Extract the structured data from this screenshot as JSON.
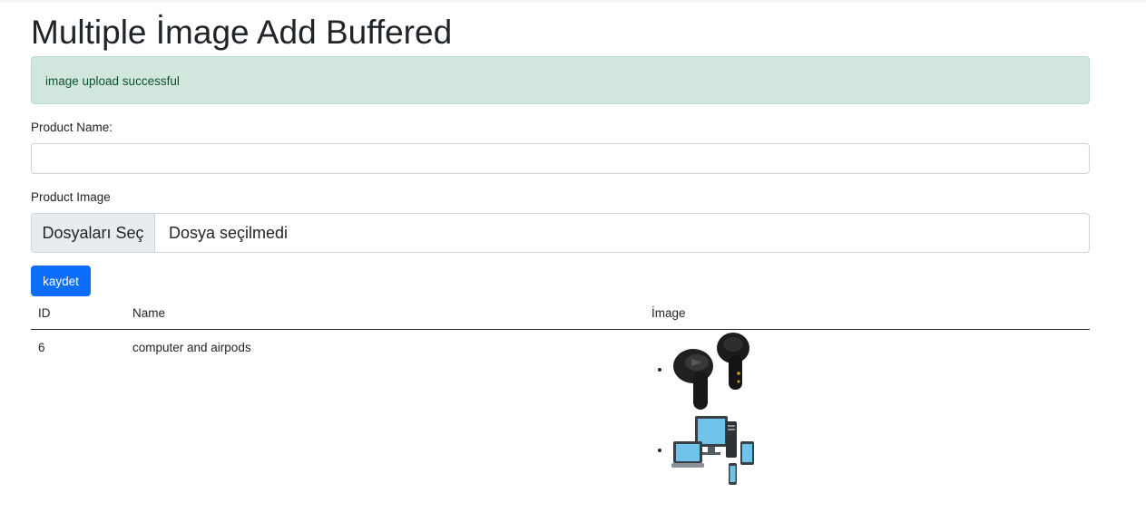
{
  "page": {
    "title": "Multiple İmage Add Buffered"
  },
  "alert": {
    "message": "image upload successful",
    "color": "#d1e7dd"
  },
  "form": {
    "product_name_label": "Product Name:",
    "product_name_value": "",
    "product_image_label": "Product Image",
    "file_button_label": "Dosyaları Seç",
    "file_status_text": "Dosya seçilmedi",
    "submit_label": "kaydet",
    "submit_color": "#0d6efd"
  },
  "table": {
    "headers": [
      "ID",
      "Name",
      "İmage"
    ],
    "rows": [
      {
        "id": "6",
        "name": "computer and airpods",
        "images": [
          "airpods-icon",
          "computer-devices-icon"
        ]
      }
    ]
  }
}
